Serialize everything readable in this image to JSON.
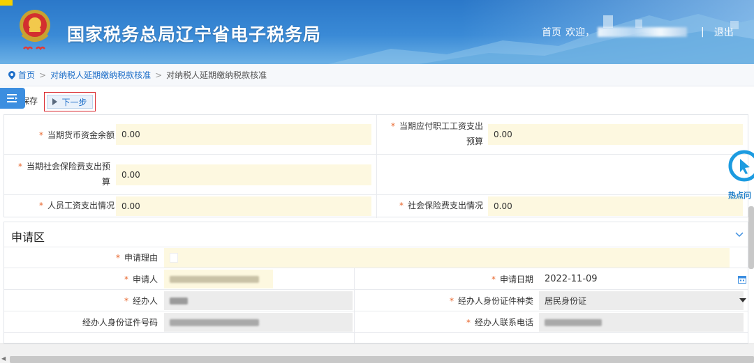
{
  "header": {
    "site_title": "国家税务总局辽宁省电子税务局",
    "nav_home": "首页",
    "nav_welcome": "欢迎，",
    "nav_sep": "|",
    "nav_logout": "退出"
  },
  "breadcrumb": {
    "home": "首页",
    "arrow": ">",
    "item1": "对纳税人延期缴纳税款核准",
    "current": "对纳税人延期缴纳税款核准"
  },
  "toolbar": {
    "save_label": "保存",
    "next_label": "下一步"
  },
  "form1": {
    "required_mark": "*",
    "field1_label": "当期货币资金余额",
    "field1_value": "0.00",
    "field2_label_line1": "当期应付职工工资支出",
    "field2_label_line2": "预算",
    "field2_value": "0.00",
    "field3_label_line1": "当期社会保险费支出预",
    "field3_label_line2": "算",
    "field3_value": "0.00",
    "field4_label": "人员工资支出情况",
    "field4_value": "0.00",
    "field5_label": "社会保险费支出情况",
    "field5_value": "0.00"
  },
  "hotspot": {
    "label": "热点问"
  },
  "apply_section": {
    "title": "申请区",
    "reason_label": "申请理由",
    "applicant_label": "申请人",
    "apply_date_label": "申请日期",
    "apply_date_value": "2022-11-09",
    "handler_label": "经办人",
    "id_type_label": "经办人身份证件种类",
    "id_type_value": "居民身份证",
    "id_number_label": "经办人身份证件号码",
    "phone_label": "经办人联系电话"
  },
  "icons": {
    "logo": "tax-emblem-icon",
    "breadcrumb": "location-pin-icon",
    "menu": "menu-toggle-icon",
    "next": "play-triangle-icon",
    "collapse": "chevron-down-icon",
    "calendar": "calendar-icon",
    "dropdown": "caret-down-icon",
    "hotspot": "hotspot-cursor-icon"
  },
  "colors": {
    "header_blue": "#2b78c9",
    "link_blue": "#1f6fc9",
    "required_orange": "#e8662c",
    "input_yellow": "#fdf8e0",
    "highlight_red": "#d9262c"
  }
}
